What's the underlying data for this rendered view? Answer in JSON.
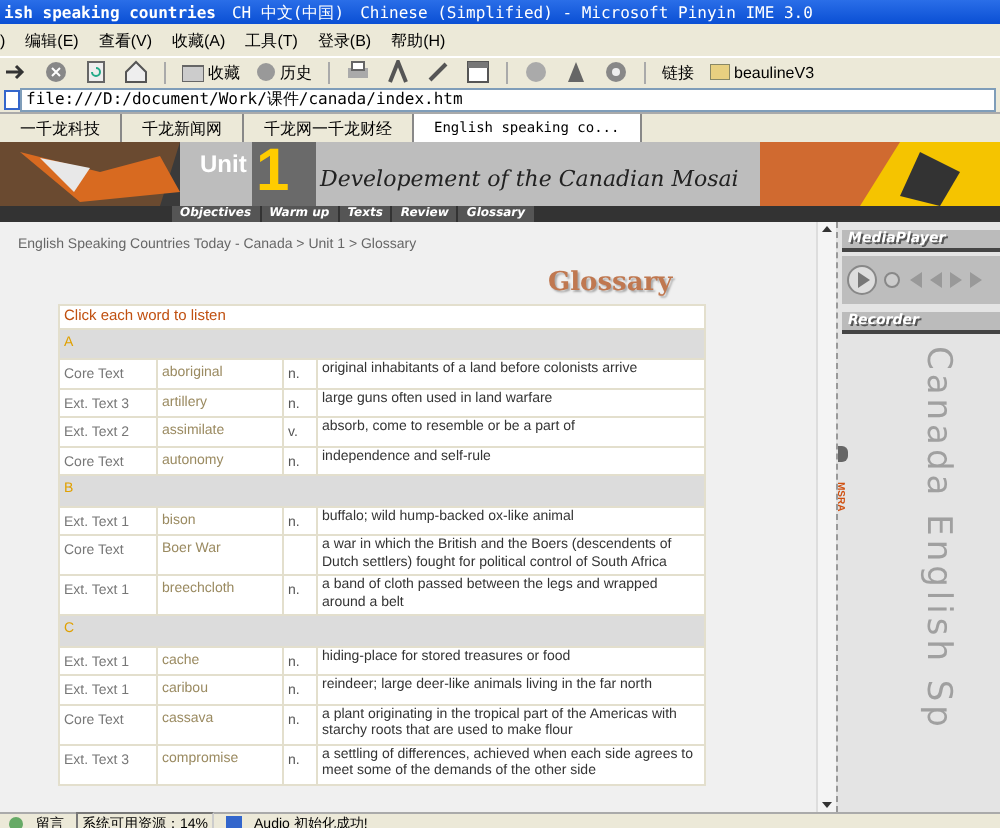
{
  "window": {
    "title": "ish speaking countries",
    "ime": "CH 中文(中国)",
    "ime_name": "Chinese (Simplified) - Microsoft Pinyin IME 3.0"
  },
  "menu": [
    ")",
    "编辑(E)",
    "查看(V)",
    "收藏(A)",
    "工具(T)",
    "登录(B)",
    "帮助(H)"
  ],
  "toolbar": {
    "favorites": "收藏",
    "history": "历史",
    "links": "链接",
    "link_item": "beaulineV3"
  },
  "address": {
    "value": "file:///D:/document/Work/课件/canada/index.htm"
  },
  "tabs": [
    {
      "label": "一千龙科技",
      "selected": false
    },
    {
      "label": "千龙新闻网",
      "selected": false
    },
    {
      "label": "千龙网一千龙财经",
      "selected": false
    },
    {
      "label": "English speaking co...",
      "selected": true
    }
  ],
  "banner": {
    "unit_word": "Unit",
    "unit_number": "1",
    "title": "Developement of the Canadian Mosai"
  },
  "nav": [
    {
      "label": "Objectives"
    },
    {
      "label": "Warm up"
    },
    {
      "label": "Texts"
    },
    {
      "label": "Review"
    },
    {
      "label": "Glossary"
    }
  ],
  "breadcrumb": "English Speaking Countries Today - Canada > Unit 1 > Glossary",
  "heading": "Glossary",
  "instruction": "Click each word to listen",
  "sections": [
    {
      "letter": "A",
      "rows": [
        {
          "source": "Core Text",
          "word": "aboriginal",
          "pos": "n.",
          "definition": "original inhabitants of a land before colonists arrive"
        },
        {
          "source": "Ext. Text 3",
          "word": "artillery",
          "pos": "n.",
          "definition": "large guns often used in land warfare"
        },
        {
          "source": "Ext. Text 2",
          "word": "assimilate",
          "pos": "v.",
          "definition": "absorb, come to resemble or be a part of"
        },
        {
          "source": "Core Text",
          "word": "autonomy",
          "pos": "n.",
          "definition": "independence and self-rule"
        }
      ]
    },
    {
      "letter": "B",
      "rows": [
        {
          "source": "Ext. Text 1",
          "word": "bison",
          "pos": "n.",
          "definition": "buffalo; wild hump-backed ox-like animal"
        },
        {
          "source": "Core Text",
          "word": "Boer War",
          "definition": "a war in which the British and the Boers (descendents of Dutch settlers) fought for political control of South Africa"
        },
        {
          "source": "Ext. Text 1",
          "word": "breechcloth",
          "pos": "n.",
          "definition": "a band of cloth passed between the legs and wrapped around a belt"
        }
      ]
    },
    {
      "letter": "C",
      "rows": [
        {
          "source": "Ext. Text 1",
          "word": "cache",
          "pos": "n.",
          "definition": "hiding-place for stored treasures or food"
        },
        {
          "source": "Ext. Text 1",
          "word": "caribou",
          "pos": "n.",
          "definition": "reindeer; large deer-like animals living in the far north"
        },
        {
          "source": "Core Text",
          "word": "cassava",
          "pos": "n.",
          "definition": "a plant originating in the tropical part of the Americas with starchy roots that are used to make flour"
        },
        {
          "source": "Ext. Text 3",
          "word": "compromise",
          "pos": "n.",
          "definition": "a settling of differences, achieved when each side agrees to meet some of the demands of the other side"
        }
      ]
    }
  ],
  "side_panel": {
    "media_player": "MediaPlayer",
    "recorder": "Recorder",
    "tab": "MSRA",
    "watermark": "Canada English Sp"
  },
  "status_bar": {
    "message": "留言",
    "resources": "系统可用资源：14%",
    "audio": "Audio 初始化成功!"
  }
}
